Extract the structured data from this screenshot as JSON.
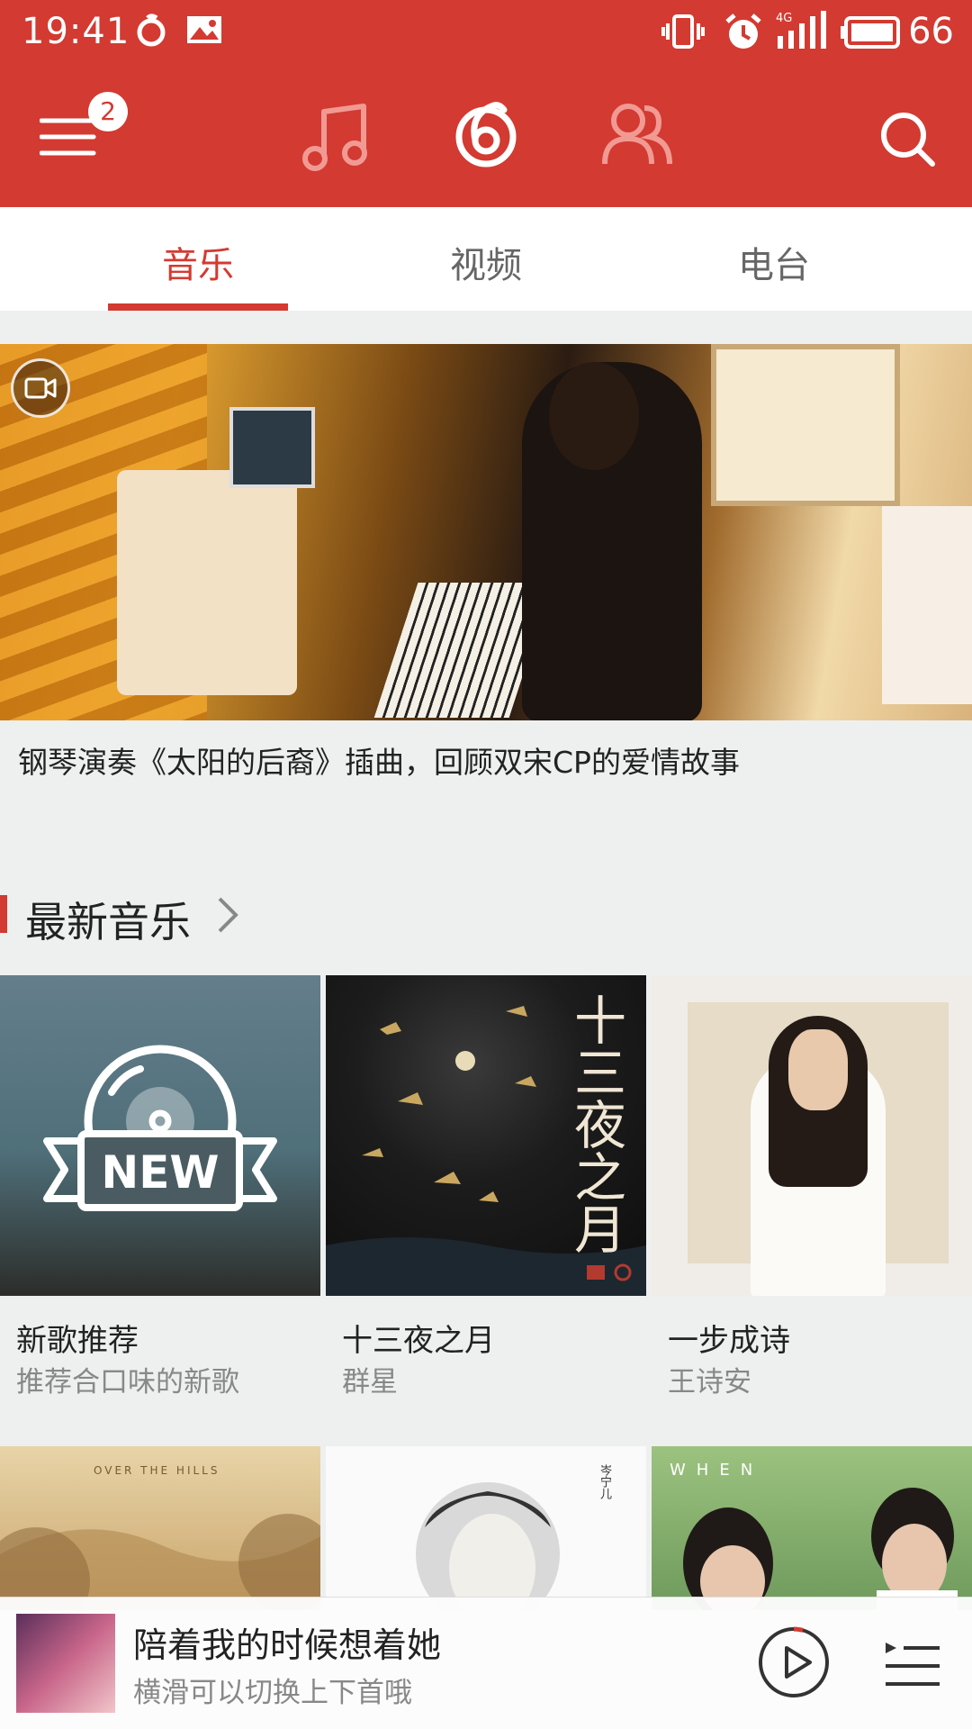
{
  "status_bar": {
    "time": "19:41",
    "network": "4G",
    "battery_level": "66"
  },
  "top_nav": {
    "menu_badge": "2",
    "icons": [
      "menu-icon",
      "music-note-icon",
      "netease-logo-icon",
      "friends-icon",
      "search-icon"
    ]
  },
  "sub_tabs": {
    "music": "音乐",
    "video": "视频",
    "radio": "电台",
    "active": "music"
  },
  "banner": {
    "caption": "钢琴演奏《太阳的后裔》插曲，回顾双宋CP的爱情故事"
  },
  "section": {
    "title": "最新音乐"
  },
  "albums": [
    {
      "title": "新歌推荐",
      "subtitle": "推荐合口味的新歌",
      "cover_text": "NEW"
    },
    {
      "title": "十三夜之月",
      "subtitle": "群星",
      "cover_text": "十三夜之月"
    },
    {
      "title": "一步成诗",
      "subtitle": "王诗安"
    }
  ],
  "row2_cover_texts": [
    "OVER THE HILLS",
    "岑宁儿",
    "WHEN"
  ],
  "player": {
    "title": "陪着我的时候想着她",
    "subtitle": "横滑可以切换上下首哦"
  },
  "colors": {
    "brand_red": "#d33a31",
    "background": "#eef0f0"
  }
}
